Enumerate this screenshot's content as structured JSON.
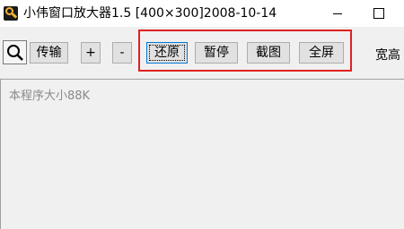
{
  "window": {
    "title": "小伟窗口放大器1.5 [400×300]2008-10-14",
    "icon": "magnifier-app-icon"
  },
  "toolbar": {
    "magnifier_icon": "magnifier-icon",
    "transfer_label": "传输",
    "zoom_in_label": "+",
    "zoom_out_label": "-",
    "restore_label": "还原",
    "pause_label": "暂停",
    "screenshot_label": "截图",
    "fullscreen_label": "全屏",
    "width_height_label": "宽高"
  },
  "content": {
    "info_text": "本程序大小88K"
  },
  "colors": {
    "highlight": "#e02020",
    "focus_border": "#0078d7",
    "button_bg": "#e1e1e1",
    "toolbar_bg": "#f0f0f0"
  }
}
